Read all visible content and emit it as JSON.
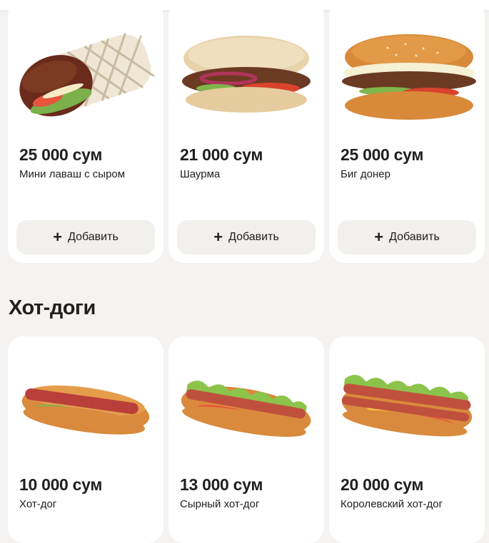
{
  "sections": [
    {
      "title": "",
      "products": [
        {
          "price": "25 000 сум",
          "name": "Мини лаваш с сыром",
          "add_label": "Добавить",
          "image_icon": "wrap-lavash-icon"
        },
        {
          "price": "21 000 сум",
          "name": "Шаурма",
          "add_label": "Добавить",
          "image_icon": "shawarma-pita-icon"
        },
        {
          "price": "25 000 сум",
          "name": "Биг донер",
          "add_label": "Добавить",
          "image_icon": "doner-burger-icon"
        }
      ]
    },
    {
      "title": "Хот-доги",
      "products": [
        {
          "price": "10 000 сум",
          "name": "Хот-дог",
          "image_icon": "hotdog-icon"
        },
        {
          "price": "13 000 сум",
          "name": "Сырный хот-дог",
          "image_icon": "hotdog-lettuce-icon"
        },
        {
          "price": "20 000 сум",
          "name": "Королевский хот-дог",
          "image_icon": "hotdog-cheese-icon"
        }
      ]
    }
  ],
  "add_icon": "plus-icon",
  "colors": {
    "background": "#f4f3f1",
    "card": "#ffffff",
    "button": "#f1f0ed",
    "text": "#21201f"
  }
}
